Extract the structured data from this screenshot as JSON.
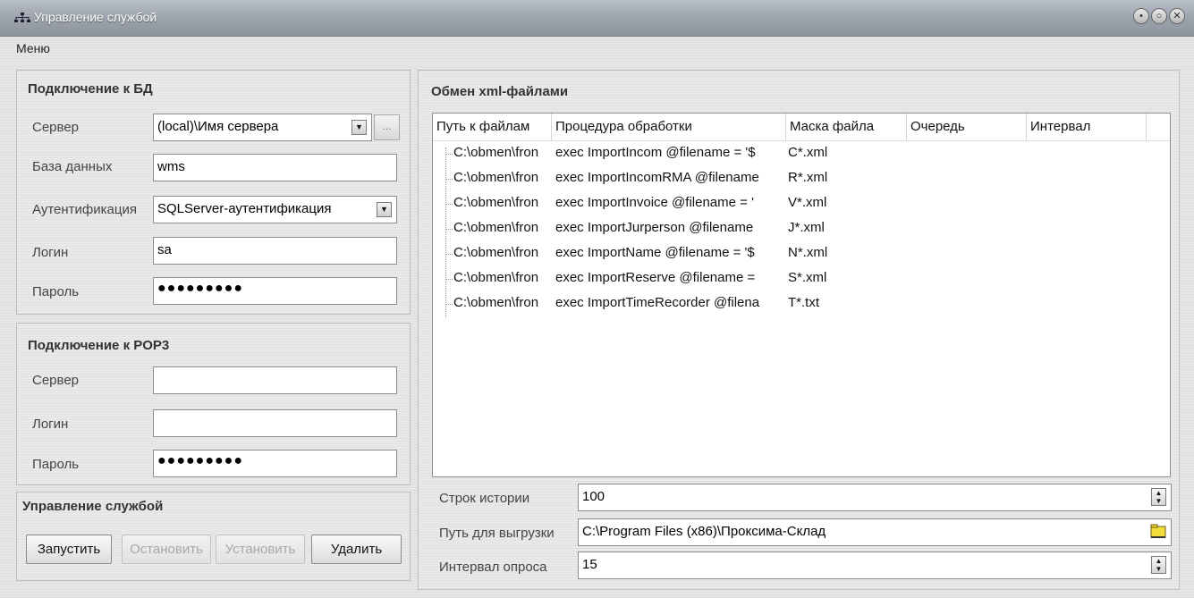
{
  "window": {
    "title": "Управление службой"
  },
  "menu": {
    "items": [
      "Меню"
    ]
  },
  "db_group": {
    "title": "Подключение к БД",
    "server_label": "Сервер",
    "server_value": "(local)\\Имя сервера",
    "db_label": "База данных",
    "db_value": "wms",
    "auth_label": "Аутентификация",
    "auth_value": "SQLServer-аутентификация",
    "login_label": "Логин",
    "login_value": "sa",
    "password_label": "Пароль",
    "password_value": "●●●●●●●●●",
    "browse_label": "..."
  },
  "pop3_group": {
    "title": "Подключение к POP3",
    "server_label": "Сервер",
    "server_value": "",
    "login_label": "Логин",
    "login_value": "",
    "password_label": "Пароль",
    "password_value": "●●●●●●●●●"
  },
  "service_group": {
    "title": "Управление службой",
    "start": "Запустить",
    "stop": "Остановить",
    "install": "Установить",
    "delete": "Удалить"
  },
  "xml_group": {
    "title": "Обмен xml-файлами",
    "columns": [
      "Путь к файлам",
      "Процедура обработки",
      "Маска файла",
      "Очередь",
      "Интервал"
    ],
    "rows": [
      [
        "C:\\obmen\\fron",
        "exec ImportIncom @filename = '$",
        "C*.xml"
      ],
      [
        "C:\\obmen\\fron",
        "exec ImportIncomRMA @filename",
        "R*.xml"
      ],
      [
        "C:\\obmen\\fron",
        "exec ImportInvoice @filename = '",
        "V*.xml"
      ],
      [
        "C:\\obmen\\fron",
        "exec ImportJurperson @filename",
        "J*.xml"
      ],
      [
        "C:\\obmen\\fron",
        "exec ImportName @filename = '$",
        "N*.xml"
      ],
      [
        "C:\\obmen\\fron",
        "exec ImportReserve @filename =",
        "S*.xml"
      ],
      [
        "C:\\obmen\\fron",
        "exec ImportTimeRecorder @filena",
        "T*.txt"
      ]
    ],
    "history_label": "Строк истории",
    "history_value": "100",
    "export_label": "Путь для выгрузки",
    "export_value": "C:\\Program Files (x86)\\Проксима-Склад",
    "interval_label": "Интервал опроса",
    "interval_value": "15"
  },
  "icons": {
    "app": "network-icon",
    "browse": "folder-icon"
  }
}
